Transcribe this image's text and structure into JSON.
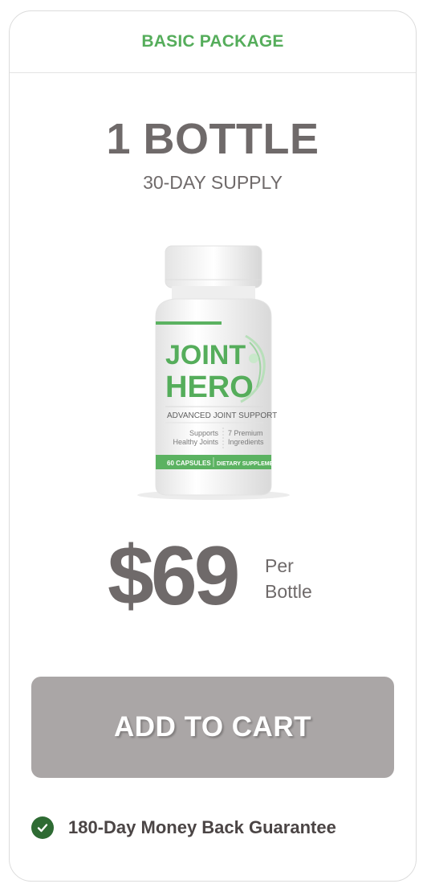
{
  "package": {
    "label": "BASIC PACKAGE"
  },
  "product": {
    "quantity_title": "1 BOTTLE",
    "supply": "30-DAY SUPPLY",
    "bottle_label": {
      "brand_line1": "JOINT",
      "brand_line2": "HERO",
      "tagline": "ADVANCED JOINT SUPPORT",
      "feature_left_1": "Supports",
      "feature_left_2": "Healthy Joints",
      "feature_right_1": "7 Premium",
      "feature_right_2": "Ingredients",
      "band_left": "60 CAPSULES",
      "band_right": "DIETARY SUPPLEMENT"
    }
  },
  "price": {
    "amount": "$69",
    "per_line1": "Per",
    "per_line2": "Bottle"
  },
  "cta": {
    "label": "ADD TO CART"
  },
  "guarantee": {
    "text": "180-Day Money Back Guarantee",
    "icon": "check-circle-icon"
  },
  "colors": {
    "accent_green": "#55ad5b",
    "dark_green": "#2e6b33",
    "text_gray": "#6f6a6a",
    "button_gray": "#aaa6a6"
  }
}
